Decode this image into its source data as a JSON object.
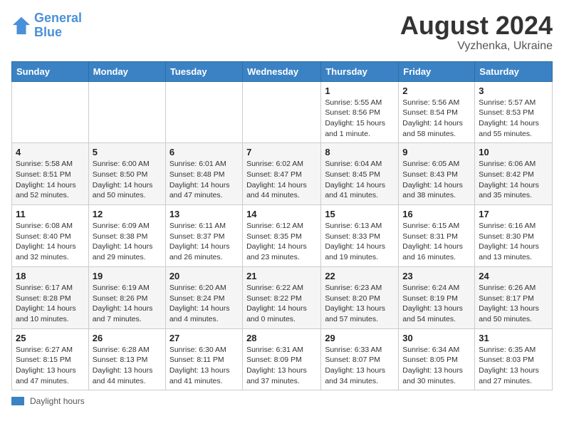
{
  "header": {
    "logo_line1": "General",
    "logo_line2": "Blue",
    "main_title": "August 2024",
    "subtitle": "Vyzhenka, Ukraine"
  },
  "days_of_week": [
    "Sunday",
    "Monday",
    "Tuesday",
    "Wednesday",
    "Thursday",
    "Friday",
    "Saturday"
  ],
  "weeks": [
    [
      {
        "num": "",
        "info": ""
      },
      {
        "num": "",
        "info": ""
      },
      {
        "num": "",
        "info": ""
      },
      {
        "num": "",
        "info": ""
      },
      {
        "num": "1",
        "info": "Sunrise: 5:55 AM\nSunset: 8:56 PM\nDaylight: 15 hours and 1 minute."
      },
      {
        "num": "2",
        "info": "Sunrise: 5:56 AM\nSunset: 8:54 PM\nDaylight: 14 hours and 58 minutes."
      },
      {
        "num": "3",
        "info": "Sunrise: 5:57 AM\nSunset: 8:53 PM\nDaylight: 14 hours and 55 minutes."
      }
    ],
    [
      {
        "num": "4",
        "info": "Sunrise: 5:58 AM\nSunset: 8:51 PM\nDaylight: 14 hours and 52 minutes."
      },
      {
        "num": "5",
        "info": "Sunrise: 6:00 AM\nSunset: 8:50 PM\nDaylight: 14 hours and 50 minutes."
      },
      {
        "num": "6",
        "info": "Sunrise: 6:01 AM\nSunset: 8:48 PM\nDaylight: 14 hours and 47 minutes."
      },
      {
        "num": "7",
        "info": "Sunrise: 6:02 AM\nSunset: 8:47 PM\nDaylight: 14 hours and 44 minutes."
      },
      {
        "num": "8",
        "info": "Sunrise: 6:04 AM\nSunset: 8:45 PM\nDaylight: 14 hours and 41 minutes."
      },
      {
        "num": "9",
        "info": "Sunrise: 6:05 AM\nSunset: 8:43 PM\nDaylight: 14 hours and 38 minutes."
      },
      {
        "num": "10",
        "info": "Sunrise: 6:06 AM\nSunset: 8:42 PM\nDaylight: 14 hours and 35 minutes."
      }
    ],
    [
      {
        "num": "11",
        "info": "Sunrise: 6:08 AM\nSunset: 8:40 PM\nDaylight: 14 hours and 32 minutes."
      },
      {
        "num": "12",
        "info": "Sunrise: 6:09 AM\nSunset: 8:38 PM\nDaylight: 14 hours and 29 minutes."
      },
      {
        "num": "13",
        "info": "Sunrise: 6:11 AM\nSunset: 8:37 PM\nDaylight: 14 hours and 26 minutes."
      },
      {
        "num": "14",
        "info": "Sunrise: 6:12 AM\nSunset: 8:35 PM\nDaylight: 14 hours and 23 minutes."
      },
      {
        "num": "15",
        "info": "Sunrise: 6:13 AM\nSunset: 8:33 PM\nDaylight: 14 hours and 19 minutes."
      },
      {
        "num": "16",
        "info": "Sunrise: 6:15 AM\nSunset: 8:31 PM\nDaylight: 14 hours and 16 minutes."
      },
      {
        "num": "17",
        "info": "Sunrise: 6:16 AM\nSunset: 8:30 PM\nDaylight: 14 hours and 13 minutes."
      }
    ],
    [
      {
        "num": "18",
        "info": "Sunrise: 6:17 AM\nSunset: 8:28 PM\nDaylight: 14 hours and 10 minutes."
      },
      {
        "num": "19",
        "info": "Sunrise: 6:19 AM\nSunset: 8:26 PM\nDaylight: 14 hours and 7 minutes."
      },
      {
        "num": "20",
        "info": "Sunrise: 6:20 AM\nSunset: 8:24 PM\nDaylight: 14 hours and 4 minutes."
      },
      {
        "num": "21",
        "info": "Sunrise: 6:22 AM\nSunset: 8:22 PM\nDaylight: 14 hours and 0 minutes."
      },
      {
        "num": "22",
        "info": "Sunrise: 6:23 AM\nSunset: 8:20 PM\nDaylight: 13 hours and 57 minutes."
      },
      {
        "num": "23",
        "info": "Sunrise: 6:24 AM\nSunset: 8:19 PM\nDaylight: 13 hours and 54 minutes."
      },
      {
        "num": "24",
        "info": "Sunrise: 6:26 AM\nSunset: 8:17 PM\nDaylight: 13 hours and 50 minutes."
      }
    ],
    [
      {
        "num": "25",
        "info": "Sunrise: 6:27 AM\nSunset: 8:15 PM\nDaylight: 13 hours and 47 minutes."
      },
      {
        "num": "26",
        "info": "Sunrise: 6:28 AM\nSunset: 8:13 PM\nDaylight: 13 hours and 44 minutes."
      },
      {
        "num": "27",
        "info": "Sunrise: 6:30 AM\nSunset: 8:11 PM\nDaylight: 13 hours and 41 minutes."
      },
      {
        "num": "28",
        "info": "Sunrise: 6:31 AM\nSunset: 8:09 PM\nDaylight: 13 hours and 37 minutes."
      },
      {
        "num": "29",
        "info": "Sunrise: 6:33 AM\nSunset: 8:07 PM\nDaylight: 13 hours and 34 minutes."
      },
      {
        "num": "30",
        "info": "Sunrise: 6:34 AM\nSunset: 8:05 PM\nDaylight: 13 hours and 30 minutes."
      },
      {
        "num": "31",
        "info": "Sunrise: 6:35 AM\nSunset: 8:03 PM\nDaylight: 13 hours and 27 minutes."
      }
    ]
  ],
  "legend": {
    "label": "Daylight hours"
  }
}
